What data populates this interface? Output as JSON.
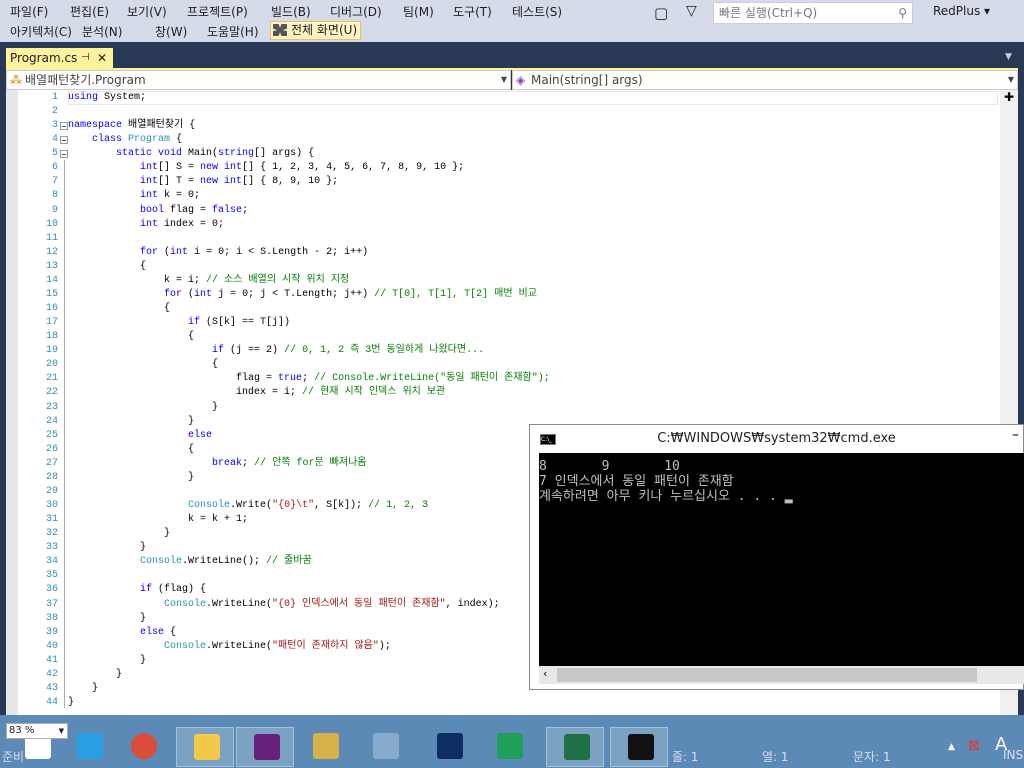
{
  "menu": {
    "row1": [
      "파일(F)",
      "편집(E)",
      "보기(V)",
      "프로젝트(P)",
      "빌드(B)",
      "디버그(D)",
      "팀(M)",
      "도구(T)",
      "테스트(S)"
    ],
    "row2": [
      "아키텍처(C)",
      "분석(N)",
      "창(W)",
      "도움말(H)"
    ],
    "fullscreen": "전체 화면(U)"
  },
  "search": {
    "placeholder": "빠른 실행(Ctrl+Q)"
  },
  "user": "RedPlus",
  "tab": {
    "label": "Program.cs"
  },
  "nav": {
    "left": "배열패턴찾기.Program",
    "right": "Main(string[] args)"
  },
  "code": [
    [
      [
        "k",
        "using"
      ],
      [
        "p",
        " System;"
      ]
    ],
    [],
    [
      [
        "k",
        "namespace"
      ],
      [
        "p",
        " 배열패턴찾기 {"
      ]
    ],
    [
      [
        "p",
        "    "
      ],
      [
        "k",
        "class"
      ],
      [
        "p",
        " "
      ],
      [
        "t",
        "Program"
      ],
      [
        "p",
        " {"
      ]
    ],
    [
      [
        "p",
        "        "
      ],
      [
        "k",
        "static void"
      ],
      [
        "p",
        " Main("
      ],
      [
        "k",
        "string"
      ],
      [
        "p",
        "[] args) {"
      ]
    ],
    [
      [
        "p",
        "            "
      ],
      [
        "k",
        "int"
      ],
      [
        "p",
        "[] S = "
      ],
      [
        "k",
        "new int"
      ],
      [
        "p",
        "[] { 1, 2, 3, 4, 5, 6, 7, 8, 9, 10 };"
      ]
    ],
    [
      [
        "p",
        "            "
      ],
      [
        "k",
        "int"
      ],
      [
        "p",
        "[] T = "
      ],
      [
        "k",
        "new int"
      ],
      [
        "p",
        "[] { 8, 9, 10 };"
      ]
    ],
    [
      [
        "p",
        "            "
      ],
      [
        "k",
        "int"
      ],
      [
        "p",
        " k = 0;"
      ]
    ],
    [
      [
        "p",
        "            "
      ],
      [
        "k",
        "bool"
      ],
      [
        "p",
        " flag = "
      ],
      [
        "k",
        "false"
      ],
      [
        "p",
        ";"
      ]
    ],
    [
      [
        "p",
        "            "
      ],
      [
        "k",
        "int"
      ],
      [
        "p",
        " index = 0;"
      ]
    ],
    [],
    [
      [
        "p",
        "            "
      ],
      [
        "k",
        "for"
      ],
      [
        "p",
        " ("
      ],
      [
        "k",
        "int"
      ],
      [
        "p",
        " i = 0; i < S.Length - 2; i++)"
      ]
    ],
    [
      [
        "p",
        "            {"
      ]
    ],
    [
      [
        "p",
        "                k = i; "
      ],
      [
        "c",
        "// 소스 배열의 시작 위치 지정"
      ]
    ],
    [
      [
        "p",
        "                "
      ],
      [
        "k",
        "for"
      ],
      [
        "p",
        " ("
      ],
      [
        "k",
        "int"
      ],
      [
        "p",
        " j = 0; j < T.Length; j++) "
      ],
      [
        "c",
        "// T[0], T[1], T[2] 매번 비교"
      ]
    ],
    [
      [
        "p",
        "                {"
      ]
    ],
    [
      [
        "p",
        "                    "
      ],
      [
        "k",
        "if"
      ],
      [
        "p",
        " (S[k] == T[j])"
      ]
    ],
    [
      [
        "p",
        "                    {"
      ]
    ],
    [
      [
        "p",
        "                        "
      ],
      [
        "k",
        "if"
      ],
      [
        "p",
        " (j == 2) "
      ],
      [
        "c",
        "// 0, 1, 2 즉 3번 동일하게 나왔다면..."
      ]
    ],
    [
      [
        "p",
        "                        {"
      ]
    ],
    [
      [
        "p",
        "                            flag = "
      ],
      [
        "k",
        "true"
      ],
      [
        "p",
        "; "
      ],
      [
        "c",
        "// Console.WriteLine(\"동일 패턴이 존재함\");"
      ]
    ],
    [
      [
        "p",
        "                            index = i; "
      ],
      [
        "c",
        "// 현재 시작 인덱스 위치 보관"
      ]
    ],
    [
      [
        "p",
        "                        }"
      ]
    ],
    [
      [
        "p",
        "                    }"
      ]
    ],
    [
      [
        "p",
        "                    "
      ],
      [
        "k",
        "else"
      ]
    ],
    [
      [
        "p",
        "                    {"
      ]
    ],
    [
      [
        "p",
        "                        "
      ],
      [
        "k",
        "break"
      ],
      [
        "p",
        "; "
      ],
      [
        "c",
        "// 안쪽 for문 빠져나옴"
      ]
    ],
    [
      [
        "p",
        "                    }"
      ]
    ],
    [],
    [
      [
        "p",
        "                    "
      ],
      [
        "t",
        "Console"
      ],
      [
        "p",
        ".Write("
      ],
      [
        "s",
        "\"{0}\\t\""
      ],
      [
        "p",
        ", S[k]); "
      ],
      [
        "c",
        "// 1, 2, 3"
      ]
    ],
    [
      [
        "p",
        "                    k = k + 1;"
      ]
    ],
    [
      [
        "p",
        "                }"
      ]
    ],
    [
      [
        "p",
        "            }"
      ]
    ],
    [
      [
        "p",
        "            "
      ],
      [
        "t",
        "Console"
      ],
      [
        "p",
        ".WriteLine(); "
      ],
      [
        "c",
        "// 줄바꿈"
      ]
    ],
    [],
    [
      [
        "p",
        "            "
      ],
      [
        "k",
        "if"
      ],
      [
        "p",
        " (flag) {"
      ]
    ],
    [
      [
        "p",
        "                "
      ],
      [
        "t",
        "Console"
      ],
      [
        "p",
        ".WriteLine("
      ],
      [
        "s",
        "\"{0} 인덱스에서 동일 패턴이 존재함\""
      ],
      [
        "p",
        ", index);"
      ]
    ],
    [
      [
        "p",
        "            }"
      ]
    ],
    [
      [
        "p",
        "            "
      ],
      [
        "k",
        "else"
      ],
      [
        "p",
        " {"
      ]
    ],
    [
      [
        "p",
        "                "
      ],
      [
        "t",
        "Console"
      ],
      [
        "p",
        ".WriteLine("
      ],
      [
        "s",
        "\"패턴이 존재하지 않음\""
      ],
      [
        "p",
        ");"
      ]
    ],
    [
      [
        "p",
        "            }"
      ]
    ],
    [
      [
        "p",
        "        }"
      ]
    ],
    [
      [
        "p",
        "    }"
      ]
    ],
    [
      [
        "p",
        "}"
      ]
    ]
  ],
  "cmd": {
    "title": "C:₩WINDOWS₩system32₩cmd.exe",
    "output": "8       9       10\n7 인덱스에서 동일 패턴이 존재함\n계속하려면 아무 키나 누르십시오 . . . ▂"
  },
  "zoom": "83 %",
  "status": {
    "ready": "준비",
    "line": "줄: 1",
    "col": "열: 1",
    "char": "문자: 1",
    "ins": "INS"
  },
  "taskbar": [
    "start",
    "internet-explorer",
    "chrome",
    "file-explorer",
    "visual-studio",
    "tools",
    "notepad",
    "visual-studio-code",
    "visual-studio-green",
    "excel",
    "cmd"
  ]
}
